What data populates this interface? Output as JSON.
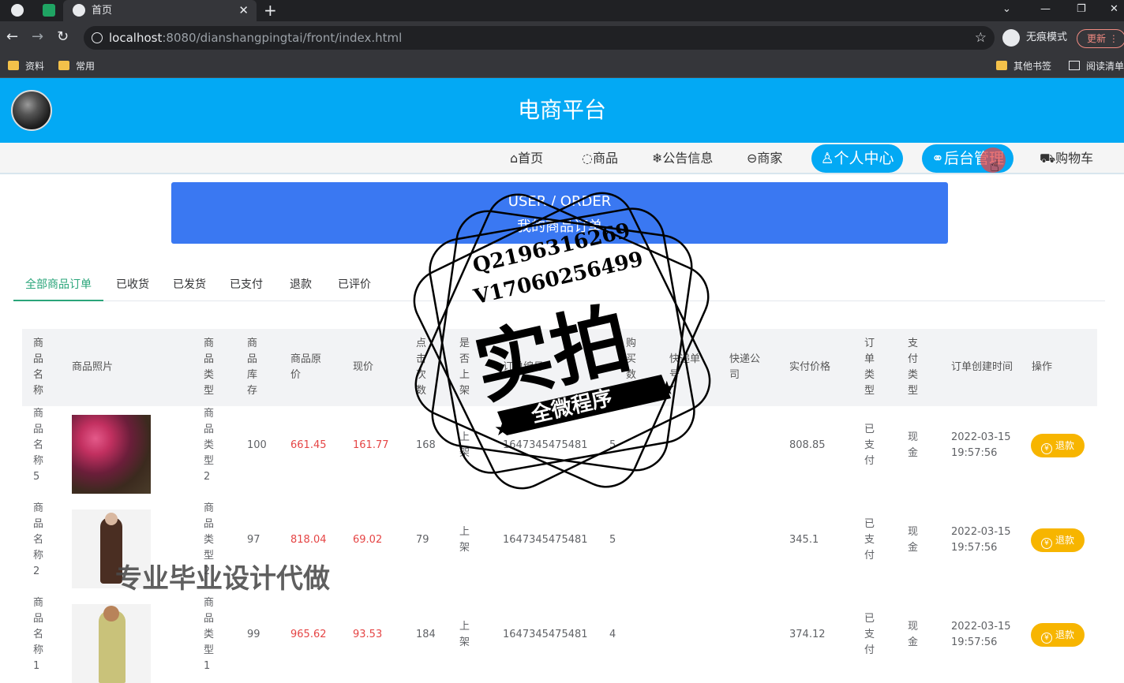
{
  "browser": {
    "tab_title": "首页",
    "url_host": "localhost",
    "url_path": ":8080/dianshangpingtai/front/index.html",
    "incognito_label": "无痕模式",
    "update_label": "更新",
    "bookmarks": [
      "资料",
      "常用"
    ],
    "other_bookmarks": "其他书签",
    "reading_list": "阅读清单"
  },
  "site": {
    "title": "电商平台",
    "nav": [
      "首页",
      "商品",
      "公告信息",
      "商家",
      "个人中心",
      "后台管理",
      "购物车"
    ]
  },
  "banner": {
    "en": "USER / ORDER",
    "cn": "我的商品订单"
  },
  "order_tabs": [
    "全部商品订单",
    "已收货",
    "已发货",
    "已支付",
    "退款",
    "已评价"
  ],
  "table": {
    "headers": [
      "商品名称",
      "商品照片",
      "商品类型",
      "商品库存",
      "商品原价",
      "现价",
      "点击次数",
      "是否上架",
      "订单编号",
      "购买数量",
      "快递单号",
      "快递公司",
      "实付价格",
      "订单类型",
      "支付类型",
      "订单创建时间",
      "操作"
    ],
    "action_label": "退款",
    "rows": [
      {
        "name": "商品名称5",
        "type": "商品类型2",
        "stock": "100",
        "price": "661.45",
        "now": "161.77",
        "clicks": "168",
        "status": "上架",
        "order_no": "1647345475481",
        "qty": "5",
        "paid": "808.85",
        "order_type": "已支付",
        "pay_type": "现金",
        "date": "2022-03-15",
        "time": "19:57:56"
      },
      {
        "name": "商品名称2",
        "type": "商品类型2",
        "stock": "97",
        "price": "818.04",
        "now": "69.02",
        "clicks": "79",
        "status": "上架",
        "order_no": "1647345475481",
        "qty": "5",
        "paid": "345.1",
        "order_type": "已支付",
        "pay_type": "现金",
        "date": "2022-03-15",
        "time": "19:57:56"
      },
      {
        "name": "商品名称1",
        "type": "商品类型1",
        "stock": "99",
        "price": "965.62",
        "now": "93.53",
        "clicks": "184",
        "status": "上架",
        "order_no": "1647345475481",
        "qty": "4",
        "paid": "374.12",
        "order_type": "已支付",
        "pay_type": "现金",
        "date": "2022-03-15",
        "time": "19:57:56"
      }
    ]
  },
  "watermark": {
    "line1": "Q2196316269",
    "line2": "V17060256499",
    "big": "实拍",
    "ribbon": "全微程序",
    "bottom": "专业毕业设计代做"
  },
  "colors": {
    "header": "#03a9f4",
    "banner": "#3a78f2",
    "active_tab": "#2aa57a",
    "price_red": "#e54545",
    "refund": "#f7b500"
  }
}
